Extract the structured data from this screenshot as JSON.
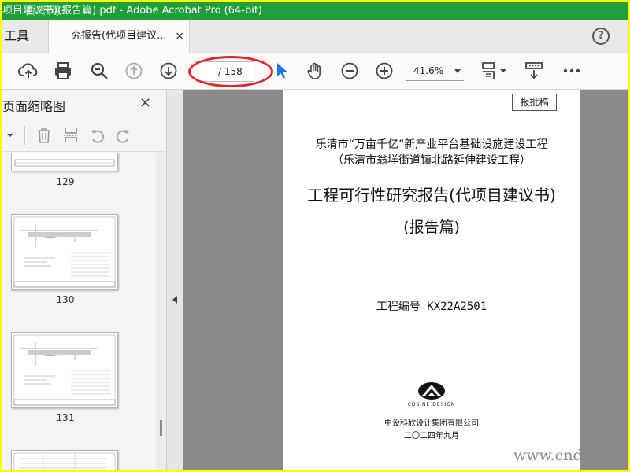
{
  "window": {
    "title": "项目建议书)(报告篇).pdf - Adobe Acrobat Pro (64-bit)",
    "watermark": "百杯网"
  },
  "tabs": {
    "tools_label": "工具",
    "doc_label": "究报告(代项目建议...",
    "close_glyph": "×",
    "help_glyph": "?"
  },
  "toolbar": {
    "icons": [
      "upload-icon",
      "print-icon",
      "zoom-search-icon",
      "page-up-icon",
      "page-down-icon",
      "select-arrow-icon",
      "hand-icon",
      "zoom-out-icon",
      "zoom-in-icon",
      "page-display-icon",
      "scroll-mode-icon",
      "more-icon"
    ],
    "page_total": "/ 158",
    "zoom": "41.6%",
    "highlight_color": "#e0262b"
  },
  "panel": {
    "title": "页面缩略图",
    "close_glyph": "×",
    "thumbnails": [
      {
        "label": "129"
      },
      {
        "label": "130"
      },
      {
        "label": "131"
      }
    ]
  },
  "document": {
    "stamp": "报批稿",
    "line1": "乐清市“万亩千亿”新产业平台基础设施建设工程",
    "line2": "（乐清市翁垟街道镇北路延伸建设工程）",
    "title": "工程可行性研究报告(代项目建议书)",
    "subtitle": "(报告篇)",
    "project_no": "工程编号  KX22A2501",
    "logo_text": "CDSINE DESIGN",
    "company": "中设科欣设计集团有限公司",
    "date": "二〇二四年九月"
  },
  "site_watermark": "www.cnda",
  "colors": {
    "titlebar": "#1f9e3a",
    "frame": "#ffff00",
    "accent_blue": "#1a73e8"
  }
}
